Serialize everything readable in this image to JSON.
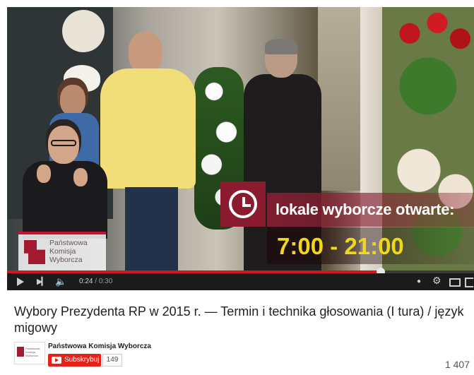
{
  "video": {
    "overlay_logo": [
      "Państwowa",
      "Komisja",
      "Wyborcza"
    ],
    "overlay_text_top": "lokale wyborcze otwarte:",
    "overlay_text_hours": "7:00 - 21:00",
    "controls": {
      "current_time": "0:24",
      "separator": " / ",
      "duration": "0:30",
      "progress_fraction": 0.8,
      "icons": [
        "play-icon",
        "next-icon",
        "volume-icon",
        "cc-icon",
        "gear-icon",
        "theater-icon",
        "fullscreen-icon"
      ]
    }
  },
  "title": "Wybory Prezydenta RP w 2015 r. — Termin i technika głosowania (I tura) / język migowy",
  "channel": {
    "name": "Państwowa Komisja Wyborcza",
    "subscribe_label": "Subskrybuj",
    "subscriber_count": "149"
  },
  "views": "1 407",
  "colors": {
    "progress": "#cc181e",
    "subscribe": "#e62117",
    "brand": "#a11a2f",
    "hours": "#f2d61a"
  }
}
